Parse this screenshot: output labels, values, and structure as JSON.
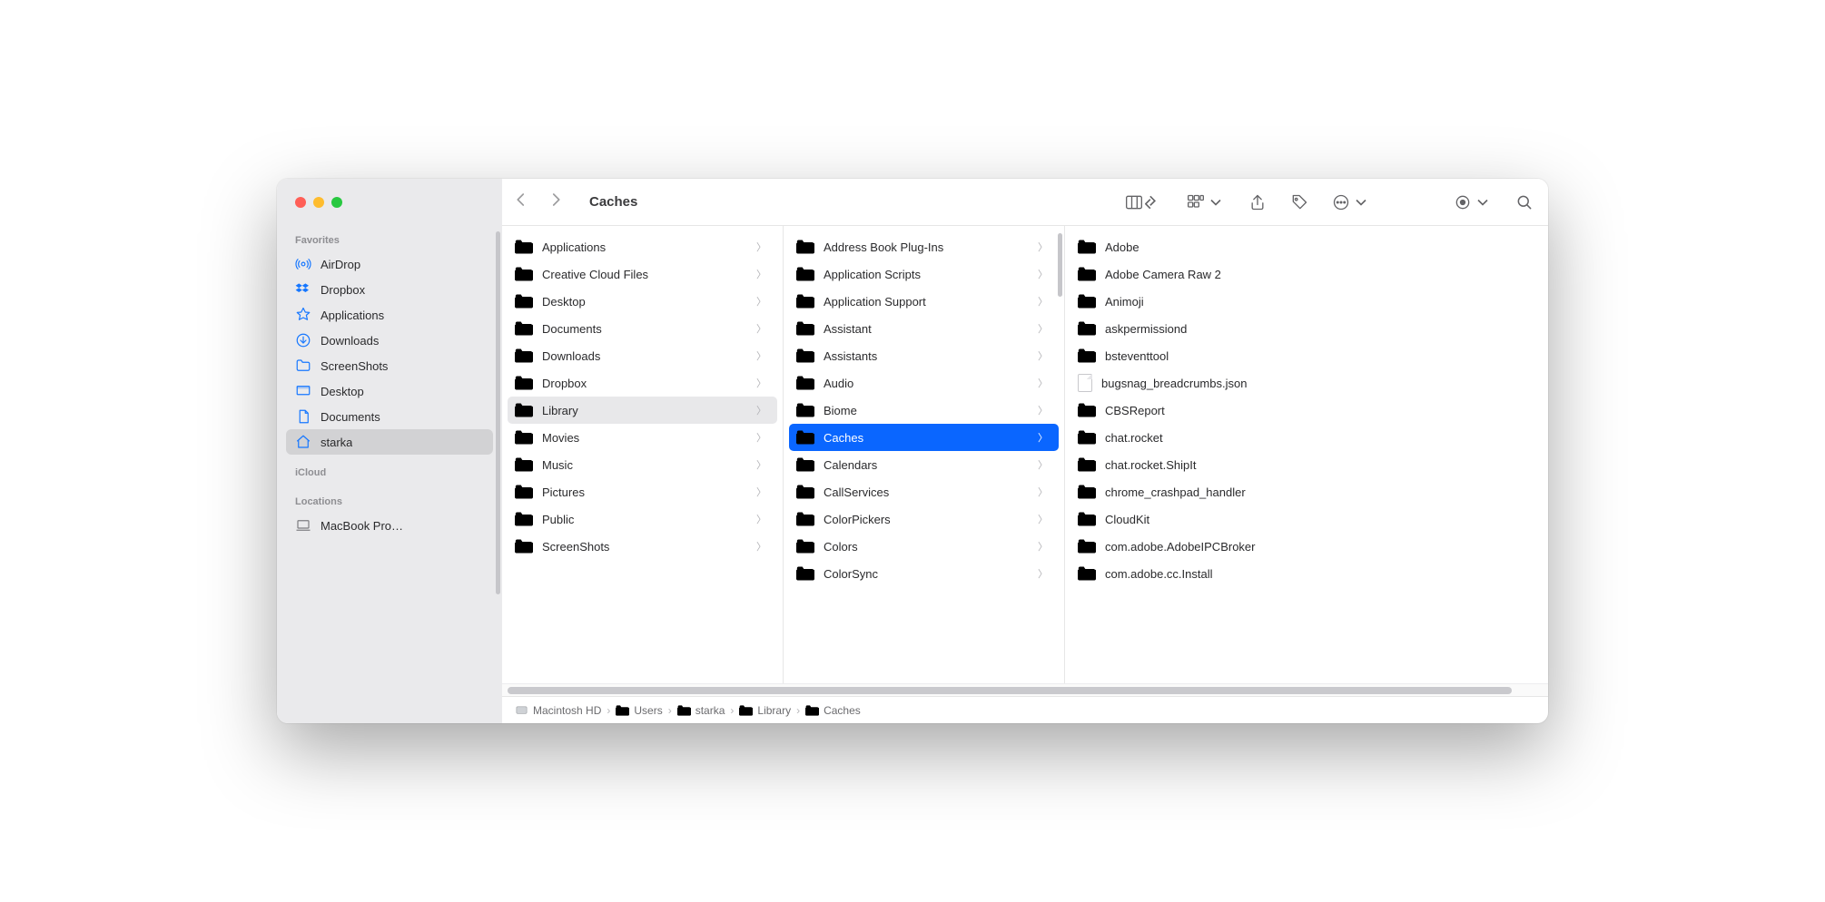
{
  "window": {
    "title": "Caches"
  },
  "sidebar": {
    "sections": [
      {
        "heading": "Favorites",
        "items": [
          {
            "icon": "airdrop",
            "label": "AirDrop"
          },
          {
            "icon": "dropbox",
            "label": "Dropbox"
          },
          {
            "icon": "applications",
            "label": "Applications"
          },
          {
            "icon": "downloads",
            "label": "Downloads"
          },
          {
            "icon": "folder",
            "label": "ScreenShots"
          },
          {
            "icon": "desktop",
            "label": "Desktop"
          },
          {
            "icon": "documents",
            "label": "Documents"
          },
          {
            "icon": "home",
            "label": "starka",
            "selected": true
          }
        ]
      },
      {
        "heading": "iCloud",
        "items": []
      },
      {
        "heading": "Locations",
        "items": [
          {
            "icon": "laptop",
            "label": "MacBook Pro…",
            "gray": true
          }
        ]
      }
    ]
  },
  "columns": [
    {
      "items": [
        {
          "name": "Applications",
          "type": "folder",
          "hasChildren": true
        },
        {
          "name": "Creative Cloud Files",
          "type": "folder",
          "hasChildren": true
        },
        {
          "name": "Desktop",
          "type": "folder",
          "hasChildren": true
        },
        {
          "name": "Documents",
          "type": "folder",
          "hasChildren": true
        },
        {
          "name": "Downloads",
          "type": "folder",
          "hasChildren": true
        },
        {
          "name": "Dropbox",
          "type": "folder",
          "hasChildren": true
        },
        {
          "name": "Library",
          "type": "folder",
          "hasChildren": true,
          "state": "dim"
        },
        {
          "name": "Movies",
          "type": "folder",
          "hasChildren": true
        },
        {
          "name": "Music",
          "type": "folder",
          "hasChildren": true
        },
        {
          "name": "Pictures",
          "type": "folder",
          "hasChildren": true
        },
        {
          "name": "Public",
          "type": "folder",
          "hasChildren": true
        },
        {
          "name": "ScreenShots",
          "type": "folder",
          "hasChildren": true
        }
      ]
    },
    {
      "scroll": true,
      "items": [
        {
          "name": "Address Book Plug-Ins",
          "type": "folder",
          "hasChildren": true
        },
        {
          "name": "Application Scripts",
          "type": "folder",
          "hasChildren": true
        },
        {
          "name": "Application Support",
          "type": "folder",
          "hasChildren": true
        },
        {
          "name": "Assistant",
          "type": "folder",
          "hasChildren": true
        },
        {
          "name": "Assistants",
          "type": "folder",
          "hasChildren": true
        },
        {
          "name": "Audio",
          "type": "folder",
          "hasChildren": true
        },
        {
          "name": "Biome",
          "type": "folder",
          "hasChildren": true
        },
        {
          "name": "Caches",
          "type": "folder",
          "hasChildren": true,
          "state": "selected"
        },
        {
          "name": "Calendars",
          "type": "folder",
          "hasChildren": true
        },
        {
          "name": "CallServices",
          "type": "folder",
          "hasChildren": true
        },
        {
          "name": "ColorPickers",
          "type": "folder",
          "hasChildren": true
        },
        {
          "name": "Colors",
          "type": "folder",
          "hasChildren": true
        },
        {
          "name": "ColorSync",
          "type": "folder",
          "hasChildren": true
        }
      ]
    },
    {
      "items": [
        {
          "name": "Adobe",
          "type": "folder"
        },
        {
          "name": "Adobe Camera Raw 2",
          "type": "folder"
        },
        {
          "name": "Animoji",
          "type": "folder"
        },
        {
          "name": "askpermissiond",
          "type": "folder"
        },
        {
          "name": "bsteventtool",
          "type": "folder"
        },
        {
          "name": "bugsnag_breadcrumbs.json",
          "type": "file"
        },
        {
          "name": "CBSReport",
          "type": "folder"
        },
        {
          "name": "chat.rocket",
          "type": "folder"
        },
        {
          "name": "chat.rocket.ShipIt",
          "type": "folder"
        },
        {
          "name": "chrome_crashpad_handler",
          "type": "folder"
        },
        {
          "name": "CloudKit",
          "type": "folder"
        },
        {
          "name": "com.adobe.AdobeIPCBroker",
          "type": "folder"
        },
        {
          "name": "com.adobe.cc.Install",
          "type": "folder"
        }
      ]
    }
  ],
  "pathbar": [
    {
      "icon": "disk",
      "label": "Macintosh HD"
    },
    {
      "icon": "folder",
      "label": "Users"
    },
    {
      "icon": "folder",
      "label": "starka"
    },
    {
      "icon": "folder",
      "label": "Library"
    },
    {
      "icon": "folder",
      "label": "Caches"
    }
  ]
}
